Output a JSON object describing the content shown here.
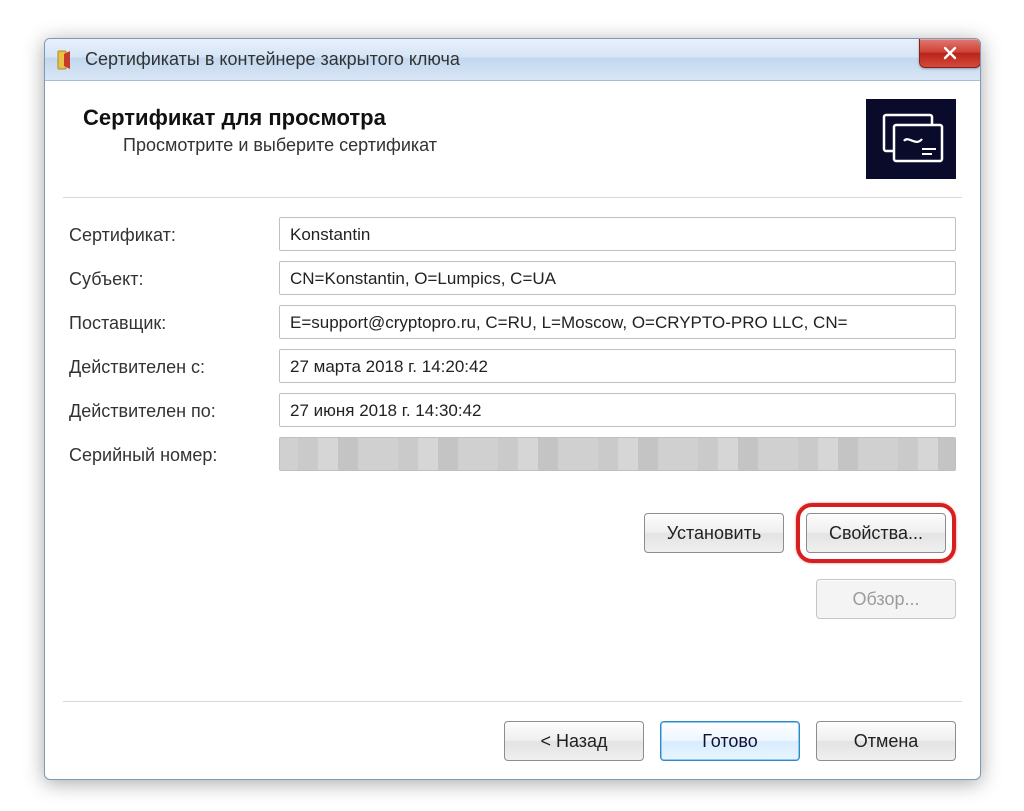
{
  "window": {
    "title": "Сертификаты в контейнере закрытого ключа"
  },
  "header": {
    "title": "Сертификат для просмотра",
    "subtitle": "Просмотрите и выберите сертификат"
  },
  "fields": {
    "certificate_label": "Сертификат:",
    "certificate_value": "Konstantin",
    "subject_label": "Субъект:",
    "subject_value": "CN=Konstantin, O=Lumpics, C=UA",
    "issuer_label": "Поставщик:",
    "issuer_value": "E=support@cryptopro.ru, C=RU, L=Moscow, O=CRYPTO-PRO LLC, CN=",
    "valid_from_label": "Действителен с:",
    "valid_from_value": "27 марта 2018 г. 14:20:42",
    "valid_to_label": "Действителен по:",
    "valid_to_value": "27 июня 2018 г. 14:30:42",
    "serial_label": "Серийный номер:"
  },
  "buttons": {
    "install": "Установить",
    "properties": "Свойства...",
    "browse": "Обзор...",
    "back": "< Назад",
    "finish": "Готово",
    "cancel": "Отмена"
  }
}
